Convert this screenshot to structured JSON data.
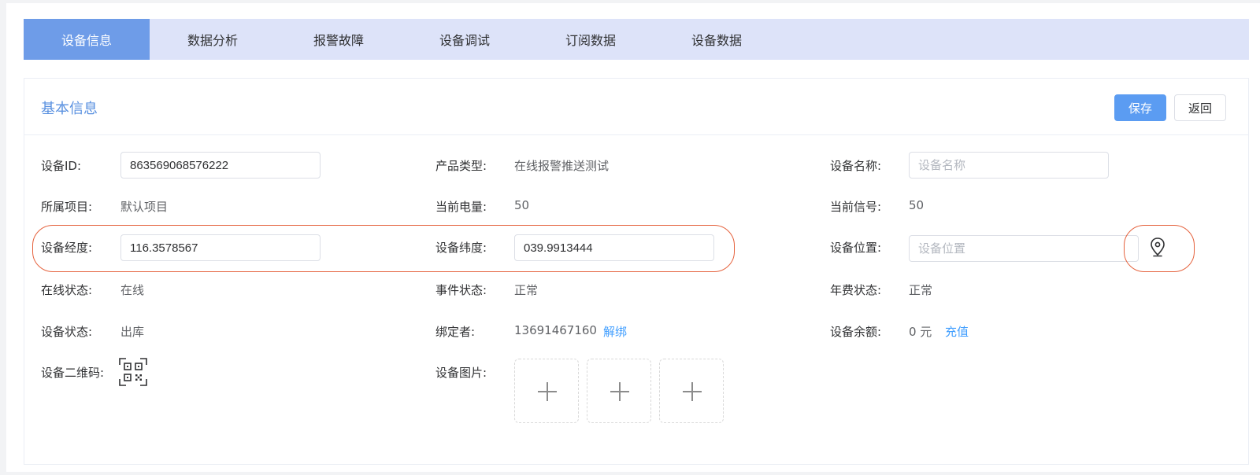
{
  "tabs": [
    {
      "label": "设备信息",
      "active": true
    },
    {
      "label": "数据分析",
      "active": false
    },
    {
      "label": "报警故障",
      "active": false
    },
    {
      "label": "设备调试",
      "active": false
    },
    {
      "label": "订阅数据",
      "active": false
    },
    {
      "label": "设备数据",
      "active": false
    }
  ],
  "card": {
    "title": "基本信息",
    "save_label": "保存",
    "back_label": "返回"
  },
  "fields": {
    "device_id": {
      "label": "设备ID:",
      "value": "863569068576222"
    },
    "product_type": {
      "label": "产品类型:",
      "value": "在线报警推送测试"
    },
    "device_name": {
      "label": "设备名称:",
      "value": "",
      "placeholder": "设备名称"
    },
    "project": {
      "label": "所属项目:",
      "value": "默认项目"
    },
    "battery": {
      "label": "当前电量:",
      "value": "50"
    },
    "signal": {
      "label": "当前信号:",
      "value": "50"
    },
    "longitude": {
      "label": "设备经度:",
      "value": "116.3578567"
    },
    "latitude": {
      "label": "设备纬度:",
      "value": "039.9913444"
    },
    "location": {
      "label": "设备位置:",
      "value": "",
      "placeholder": "设备位置"
    },
    "online_status": {
      "label": "在线状态:",
      "value": "在线"
    },
    "event_status": {
      "label": "事件状态:",
      "value": "正常"
    },
    "annual_fee_status": {
      "label": "年费状态:",
      "value": "正常"
    },
    "device_status": {
      "label": "设备状态:",
      "value": "出库"
    },
    "binder": {
      "label": "绑定者:",
      "value": "13691467160",
      "action": "解绑"
    },
    "balance": {
      "label": "设备余额:",
      "value": "0 元",
      "action": "充值"
    },
    "qrcode": {
      "label": "设备二维码:",
      "icon": "qrcode-icon"
    },
    "images": {
      "label": "设备图片:",
      "slots": 3,
      "icon": "plus-icon"
    }
  },
  "icons": {
    "map_pin": "map-pin-icon"
  },
  "colors": {
    "accent": "#409eff",
    "active_tab": "#6e9ce8",
    "tab_bar": "#dde3f9",
    "annotation": "#e5623d",
    "title": "#5a91e0"
  }
}
